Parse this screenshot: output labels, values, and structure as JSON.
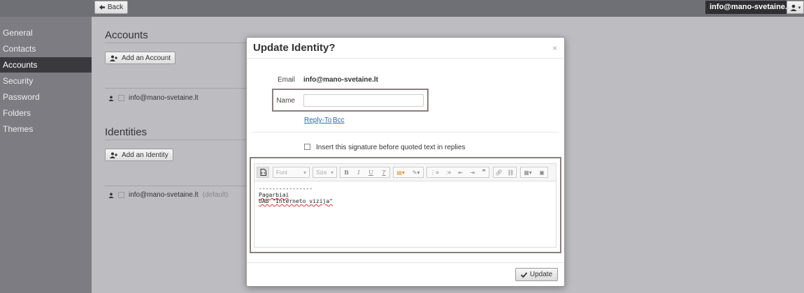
{
  "topbar": {
    "back_label": "Back",
    "account_email": "info@mano-svetaine.lt"
  },
  "sidebar": {
    "items": [
      {
        "label": "General"
      },
      {
        "label": "Contacts"
      },
      {
        "label": "Accounts"
      },
      {
        "label": "Security"
      },
      {
        "label": "Password"
      },
      {
        "label": "Folders"
      },
      {
        "label": "Themes"
      }
    ],
    "active": "Accounts"
  },
  "accounts": {
    "title": "Accounts",
    "add_label": "Add an Account",
    "items": [
      {
        "email": "info@mano-svetaine.lt"
      }
    ]
  },
  "identities": {
    "title": "Identities",
    "add_label": "Add an Identity",
    "items": [
      {
        "email": "info@mano-svetaine.lt",
        "badge": "(default)"
      }
    ]
  },
  "modal": {
    "title": "Update Identity?",
    "close": "×",
    "email_label": "Email",
    "email_value": "info@mano-svetaine.lt",
    "name_label": "Name",
    "name_value": "",
    "reply_to_link": "Reply-To",
    "bcc_link": "Bcc",
    "signature_checkbox_label": "Insert this signature before quoted text in replies",
    "signature_checked": false,
    "toolbar": {
      "font_placeholder": "Font",
      "size_placeholder": "Size"
    },
    "signature_lines": [
      "----------------",
      "Pagarbiai",
      "UAB \"Interneto vizija\""
    ],
    "update_label": "Update"
  },
  "icons": [
    "arrow-left-icon",
    "user-icon",
    "caret-down-icon",
    "user-plus-icon",
    "source-icon",
    "bold-icon",
    "italic-icon",
    "underline-icon",
    "clear-format-icon",
    "text-color-icon",
    "bg-color-icon",
    "numbered-list-icon",
    "bullet-list-icon",
    "outdent-icon",
    "indent-icon",
    "blockquote-icon",
    "link-icon",
    "unlink-icon",
    "table-icon",
    "image-icon",
    "check-icon"
  ]
}
